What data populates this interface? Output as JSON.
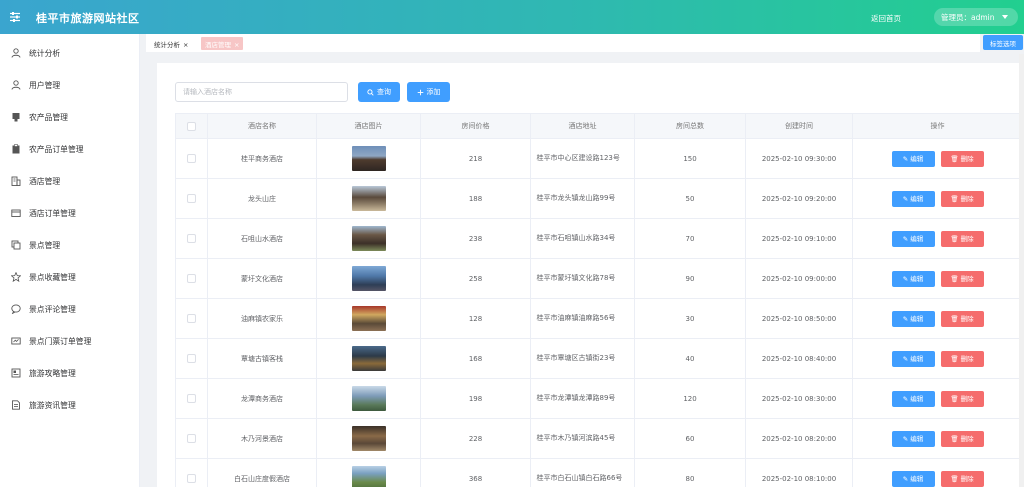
{
  "header": {
    "title": "桂平市旅游网站社区",
    "home_link": "返回首页",
    "admin_label": "管理员：admin"
  },
  "sidebar": {
    "items": [
      {
        "label": "统计分析",
        "icon": "user-icon"
      },
      {
        "label": "用户管理",
        "icon": "user-icon"
      },
      {
        "label": "农产品管理",
        "icon": "box-icon"
      },
      {
        "label": "农产品订单管理",
        "icon": "clipboard-icon"
      },
      {
        "label": "酒店管理",
        "icon": "building-icon"
      },
      {
        "label": "酒店订单管理",
        "icon": "card-icon"
      },
      {
        "label": "景点管理",
        "icon": "copy-icon"
      },
      {
        "label": "景点收藏管理",
        "icon": "star-icon"
      },
      {
        "label": "景点评论管理",
        "icon": "chat-icon"
      },
      {
        "label": "景点门票订单管理",
        "icon": "ticket-icon"
      },
      {
        "label": "旅游攻略管理",
        "icon": "book-icon"
      },
      {
        "label": "旅游资讯管理",
        "icon": "document-icon"
      }
    ]
  },
  "tabs": [
    {
      "label": "统计分析",
      "close": "×"
    },
    {
      "label": "酒店管理",
      "close": "×"
    }
  ],
  "tab_options_label": "标签选项",
  "toolbar": {
    "search_placeholder": "请输入酒店名称",
    "query_label": "查询",
    "add_label": "添加"
  },
  "table": {
    "headers": [
      "酒店名称",
      "酒店图片",
      "房间价格",
      "酒店地址",
      "房间总数",
      "创建时间",
      "操作"
    ],
    "edit_label": "编辑",
    "delete_label": "删除",
    "rows": [
      {
        "name": "桂平商务酒店",
        "price": "218",
        "address": "桂平市中心区建设路123号",
        "rooms": "150",
        "created": "2025-02-10 09:30:00"
      },
      {
        "name": "龙头山庄",
        "price": "188",
        "address": "桂平市龙头镇龙山路99号",
        "rooms": "50",
        "created": "2025-02-10 09:20:00"
      },
      {
        "name": "石咀山水酒店",
        "price": "238",
        "address": "桂平市石咀镇山水路34号",
        "rooms": "70",
        "created": "2025-02-10 09:10:00"
      },
      {
        "name": "蒙圩文化酒店",
        "price": "258",
        "address": "桂平市蒙圩镇文化路78号",
        "rooms": "90",
        "created": "2025-02-10 09:00:00"
      },
      {
        "name": "油麻镇农家乐",
        "price": "128",
        "address": "桂平市油麻镇油麻路56号",
        "rooms": "30",
        "created": "2025-02-10 08:50:00"
      },
      {
        "name": "覃塘古镇客栈",
        "price": "168",
        "address": "桂平市覃塘区古镇街23号",
        "rooms": "40",
        "created": "2025-02-10 08:40:00"
      },
      {
        "name": "龙潭商务酒店",
        "price": "198",
        "address": "桂平市龙潭镇龙潭路89号",
        "rooms": "120",
        "created": "2025-02-10 08:30:00"
      },
      {
        "name": "木乃河景酒店",
        "price": "228",
        "address": "桂平市木乃镇河滨路45号",
        "rooms": "60",
        "created": "2025-02-10 08:20:00"
      },
      {
        "name": "白石山庄度假酒店",
        "price": "368",
        "address": "桂平市白石山镇白石路66号",
        "rooms": "80",
        "created": "2025-02-10 08:10:00"
      }
    ]
  },
  "colors": {
    "header_start": "#3aa5cf",
    "header_end": "#22cf8f",
    "primary": "#409eff",
    "danger": "#f56c6c",
    "active_tab": "#f7c6c6"
  }
}
